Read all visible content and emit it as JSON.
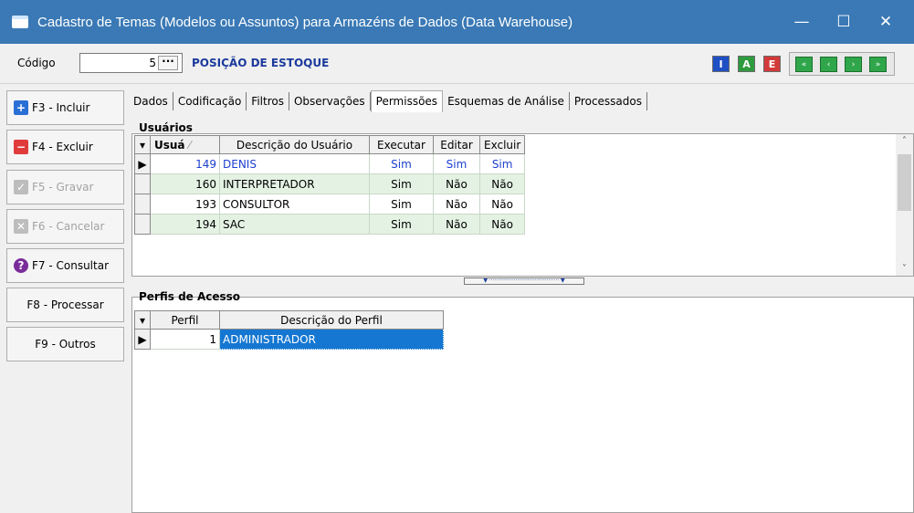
{
  "window": {
    "title": "Cadastro de Temas (Modelos ou Assuntos) para Armazéns de Dados (Data Warehouse)",
    "minimize": "—",
    "maximize": "☐",
    "close": "✕"
  },
  "header": {
    "code_label": "Código",
    "code_value": "5",
    "lookup_label": "···",
    "topic_name": "POSIÇÃO DE ESTOQUE",
    "mode_buttons": [
      "I",
      "A",
      "E"
    ],
    "mode_colors": [
      "#1f4fc4",
      "#2f9b3f",
      "#d23a3a"
    ],
    "nav_buttons": [
      "«",
      "‹",
      "›",
      "»"
    ]
  },
  "sidebar": {
    "items": [
      {
        "label": "F3 - Incluir",
        "icon": "+",
        "icon_color": "#2a6fd6",
        "enabled": true
      },
      {
        "label": "F4 - Excluir",
        "icon": "−",
        "icon_color": "#e03c3c",
        "enabled": true
      },
      {
        "label": "F5 - Gravar",
        "icon": "✓",
        "icon_color": "#bdbdbd",
        "enabled": false
      },
      {
        "label": "F6 - Cancelar",
        "icon": "✕",
        "icon_color": "#bdbdbd",
        "enabled": false
      },
      {
        "label": "F7 - Consultar",
        "icon": "?",
        "icon_color": "#7a2d9a",
        "enabled": true
      },
      {
        "label": "F8 - Processar",
        "enabled": true
      },
      {
        "label": "F9 - Outros",
        "enabled": true
      }
    ]
  },
  "tabs": [
    "Dados",
    "Codificação",
    "Filtros",
    "Observações",
    "Permissões",
    "Esquemas de Análise",
    "Processados"
  ],
  "active_tab": "Permissões",
  "users": {
    "title": "Usuários",
    "columns": [
      "Usuá",
      "Descrição do Usuário",
      "Executar",
      "Editar",
      "Excluir"
    ],
    "rows": [
      {
        "id": "149",
        "desc": "DENIS",
        "exec": "Sim",
        "edit": "Sim",
        "del": "Sim"
      },
      {
        "id": "160",
        "desc": "INTERPRETADOR",
        "exec": "Sim",
        "edit": "Não",
        "del": "Não"
      },
      {
        "id": "193",
        "desc": "CONSULTOR",
        "exec": "Sim",
        "edit": "Não",
        "del": "Não"
      },
      {
        "id": "194",
        "desc": "SAC",
        "exec": "Sim",
        "edit": "Não",
        "del": "Não"
      }
    ]
  },
  "profiles": {
    "title": "Perfis de Acesso",
    "columns": [
      "Perfil",
      "Descrição do Perfil"
    ],
    "rows": [
      {
        "id": "1",
        "desc": "ADMINISTRADOR"
      }
    ]
  }
}
